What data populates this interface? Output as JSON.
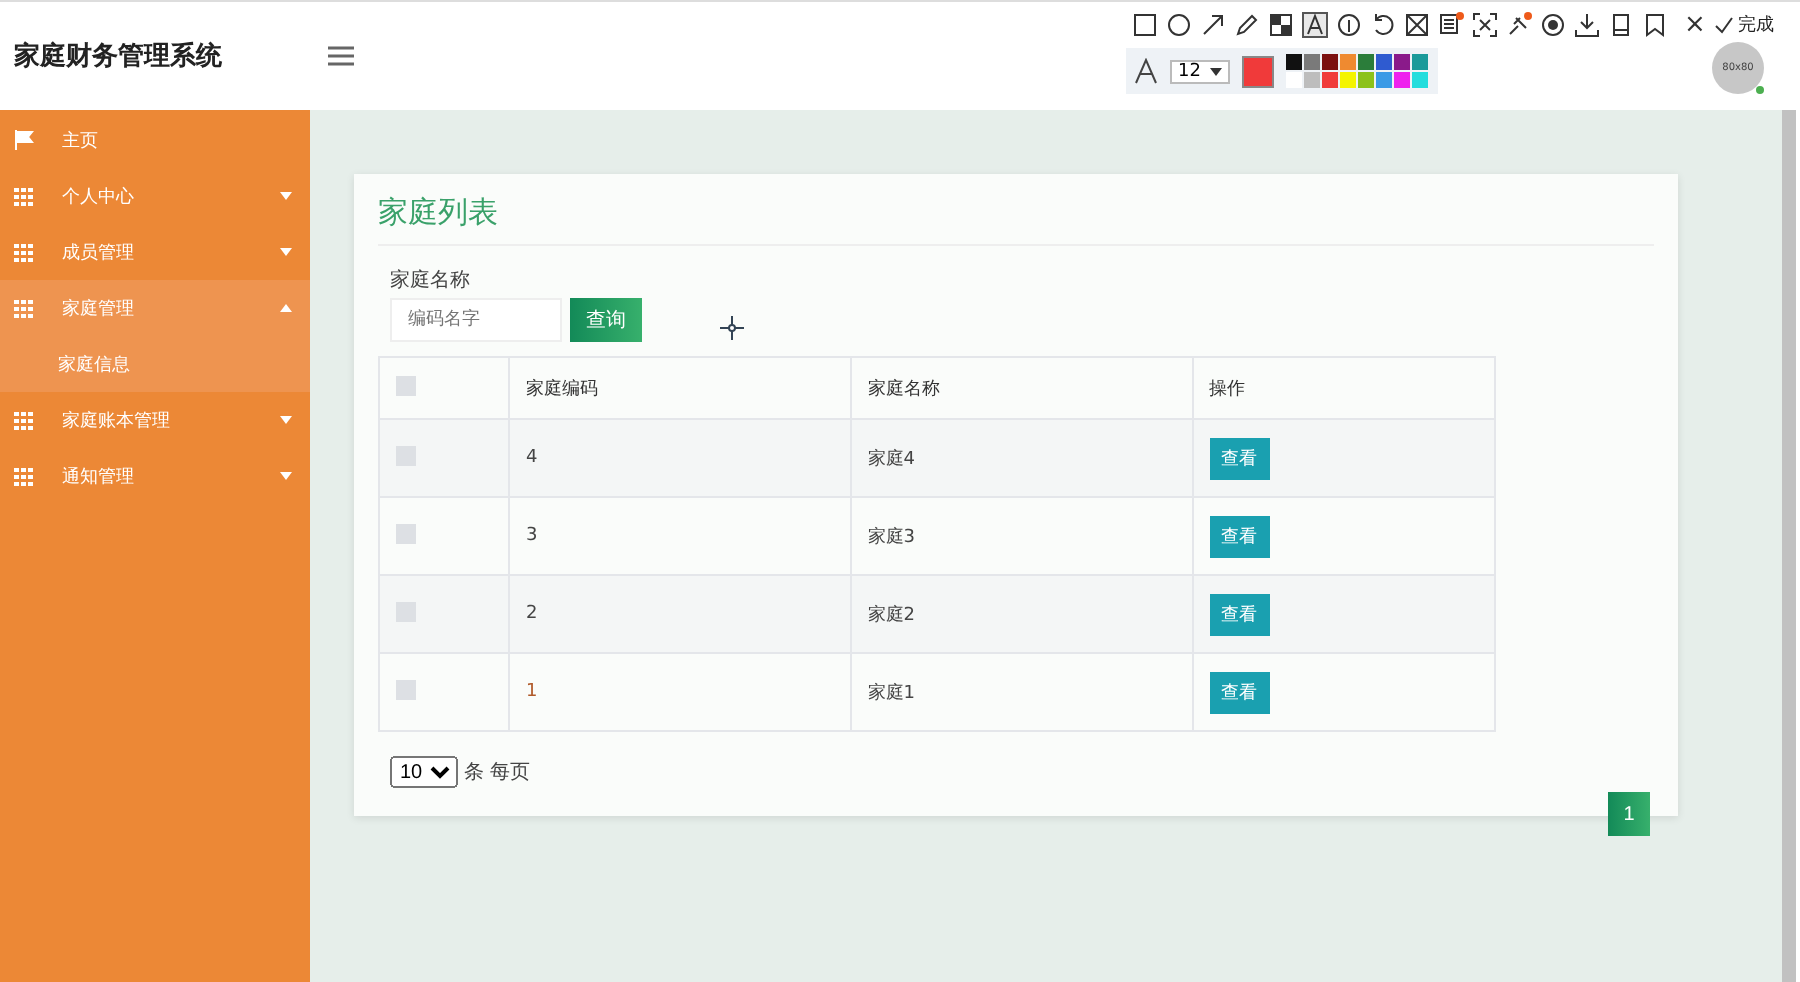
{
  "header": {
    "title": "家庭财务管理系统",
    "avatar_text": "80x80"
  },
  "annotation_toolbar": {
    "close": "×",
    "done": "完成",
    "font_size": "12",
    "palette": [
      {
        "color": "#111111"
      },
      {
        "color": "#7a7a7a"
      },
      {
        "color": "#7b1010"
      },
      {
        "color": "#ef8a30"
      },
      {
        "color": "#2b7d3a"
      },
      {
        "color": "#2f5bd0"
      },
      {
        "color": "#8a1a8a"
      },
      {
        "color": "#1a9a9a"
      },
      {
        "color": "#ffffff"
      },
      {
        "color": "#bdbdbd"
      },
      {
        "color": "#f03a3a",
        "selected": true
      },
      {
        "color": "#f4f400"
      },
      {
        "color": "#8cc21a"
      },
      {
        "color": "#3a9ae6"
      },
      {
        "color": "#ee22ee"
      },
      {
        "color": "#22dddd"
      }
    ]
  },
  "sidebar": {
    "items": [
      {
        "label": "主页",
        "kind": "flag",
        "selected": false
      },
      {
        "label": "个人中心",
        "kind": "grid",
        "expanded": false,
        "selected": false
      },
      {
        "label": "成员管理",
        "kind": "grid",
        "expanded": false,
        "selected": false
      },
      {
        "label": "家庭管理",
        "kind": "grid",
        "expanded": true,
        "selected": true,
        "children": [
          {
            "label": "家庭信息"
          }
        ]
      },
      {
        "label": "家庭账本管理",
        "kind": "grid",
        "expanded": false,
        "selected": false
      },
      {
        "label": "通知管理",
        "kind": "grid",
        "expanded": false,
        "selected": false
      }
    ]
  },
  "card": {
    "title": "家庭列表",
    "search": {
      "label": "家庭名称",
      "placeholder": "编码名字",
      "button": "查询"
    },
    "table": {
      "all_checked": false,
      "columns": [
        "家庭编码",
        "家庭名称",
        "操作"
      ],
      "rows": [
        {
          "code": "4",
          "name": "家庭4",
          "action": "查看",
          "checked": false
        },
        {
          "code": "3",
          "name": "家庭3",
          "action": "查看",
          "checked": false
        },
        {
          "code": "2",
          "name": "家庭2",
          "action": "查看",
          "checked": false
        },
        {
          "code": "1",
          "name": "家庭1",
          "action": "查看",
          "checked": false
        }
      ]
    },
    "pagination": {
      "page_size": "10",
      "page_size_suffix": "条 每页",
      "pages": [
        {
          "label": "1",
          "selected": true
        }
      ]
    }
  }
}
